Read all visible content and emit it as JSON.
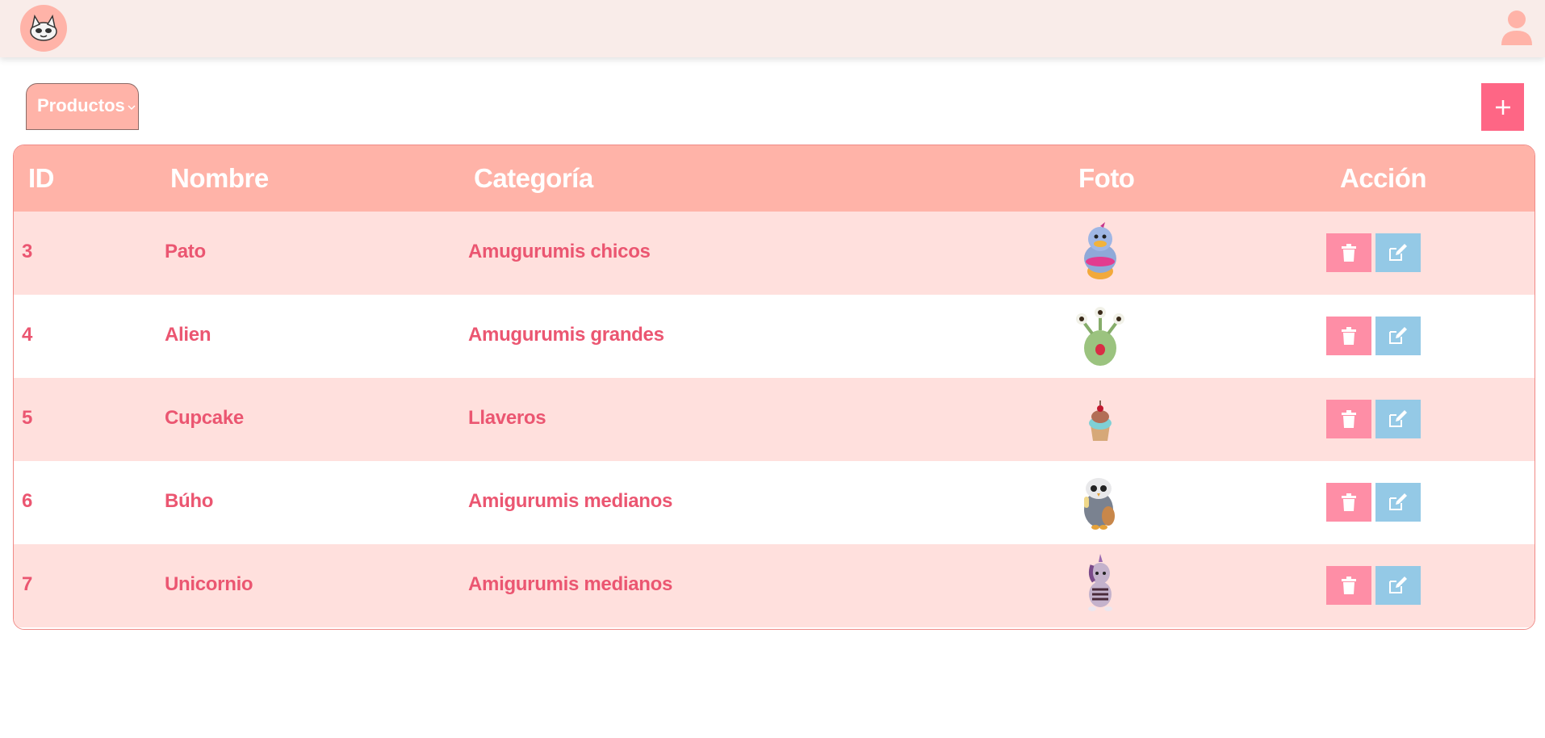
{
  "header": {
    "logo_icon": "cat-logo-icon",
    "user_icon": "user-icon"
  },
  "category_select": {
    "selected": "Productos",
    "icon": "chevron-down-icon"
  },
  "add_button": {
    "icon": "plus-icon"
  },
  "table": {
    "columns": [
      "ID",
      "Nombre",
      "Categoría",
      "Foto",
      "Acción"
    ],
    "rows": [
      {
        "id": "3",
        "nombre": "Pato",
        "categoria": "Amugurumis chicos",
        "foto": "duck-plush-photo"
      },
      {
        "id": "4",
        "nombre": "Alien",
        "categoria": "Amugurumis grandes",
        "foto": "alien-plush-photo"
      },
      {
        "id": "5",
        "nombre": "Cupcake",
        "categoria": "Llaveros",
        "foto": "cupcake-plush-photo"
      },
      {
        "id": "6",
        "nombre": "Búho",
        "categoria": "Amigurumis medianos",
        "foto": "owl-plush-photo"
      },
      {
        "id": "7",
        "nombre": "Unicornio",
        "categoria": "Amigurumis medianos",
        "foto": "unicorn-plush-photo"
      }
    ],
    "row_actions": {
      "delete_icon": "trash-icon",
      "edit_icon": "edit-icon"
    }
  },
  "colors": {
    "topbar": "#f9ece9",
    "accent": "#ffb3a8",
    "text_pink": "#eb5671",
    "row_alt": "#ffe0dd",
    "delete": "#fe8ea6",
    "edit": "#94c9e6",
    "add": "#fe6685"
  }
}
